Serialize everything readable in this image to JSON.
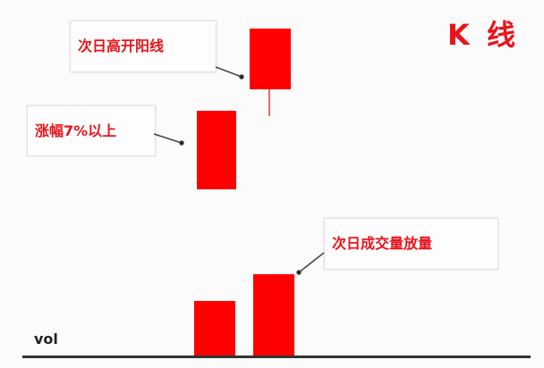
{
  "title": "K 线",
  "callouts": {
    "next_day_gap_up": "次日高开阳线",
    "rise_7pct": "涨幅7%以上",
    "next_day_volume": "次日成交量放量"
  },
  "axis_label": "vol",
  "colors": {
    "candle": "#fe0000",
    "text": "#e8141c"
  }
}
